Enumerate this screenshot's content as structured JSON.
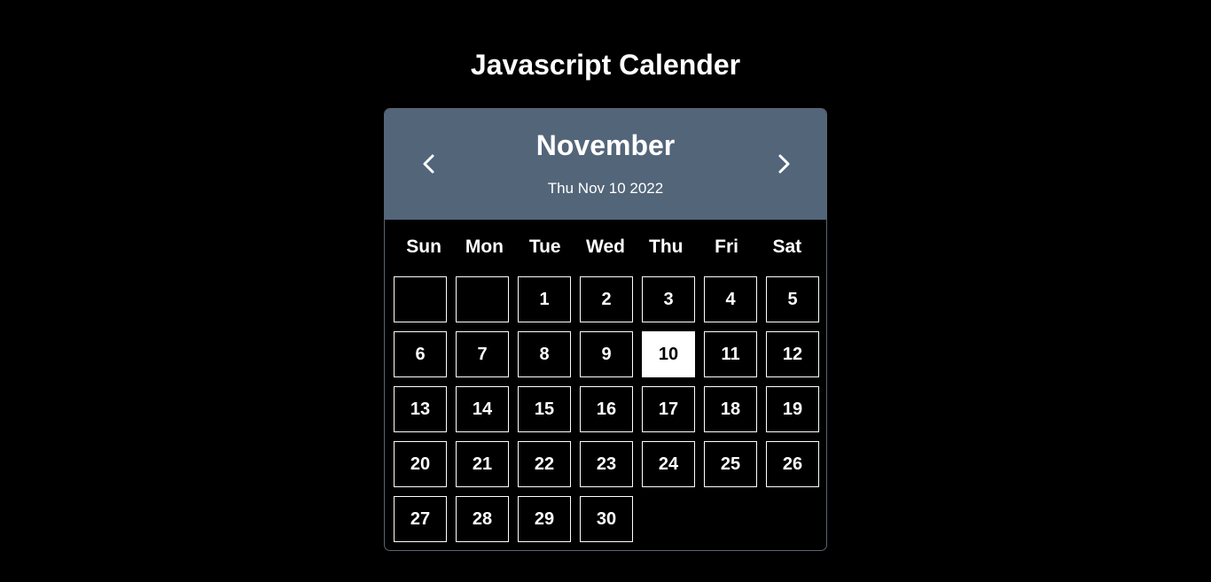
{
  "page": {
    "title": "Javascript Calender"
  },
  "calendar": {
    "month": "November",
    "current_date": "Thu Nov 10 2022",
    "prev_icon": "chevron-left-icon",
    "next_icon": "chevron-right-icon",
    "weekdays": [
      "Sun",
      "Mon",
      "Tue",
      "Wed",
      "Thu",
      "Fri",
      "Sat"
    ],
    "days": [
      "",
      "",
      "1",
      "2",
      "3",
      "4",
      "5",
      "6",
      "7",
      "8",
      "9",
      "10",
      "11",
      "12",
      "13",
      "14",
      "15",
      "16",
      "17",
      "18",
      "19",
      "20",
      "21",
      "22",
      "23",
      "24",
      "25",
      "26",
      "27",
      "28",
      "29",
      "30"
    ],
    "today": "10",
    "colors": {
      "header_bg": "#536579",
      "page_bg": "#000000",
      "text": "#ffffff",
      "today_bg": "#ffffff",
      "today_text": "#000000"
    }
  }
}
